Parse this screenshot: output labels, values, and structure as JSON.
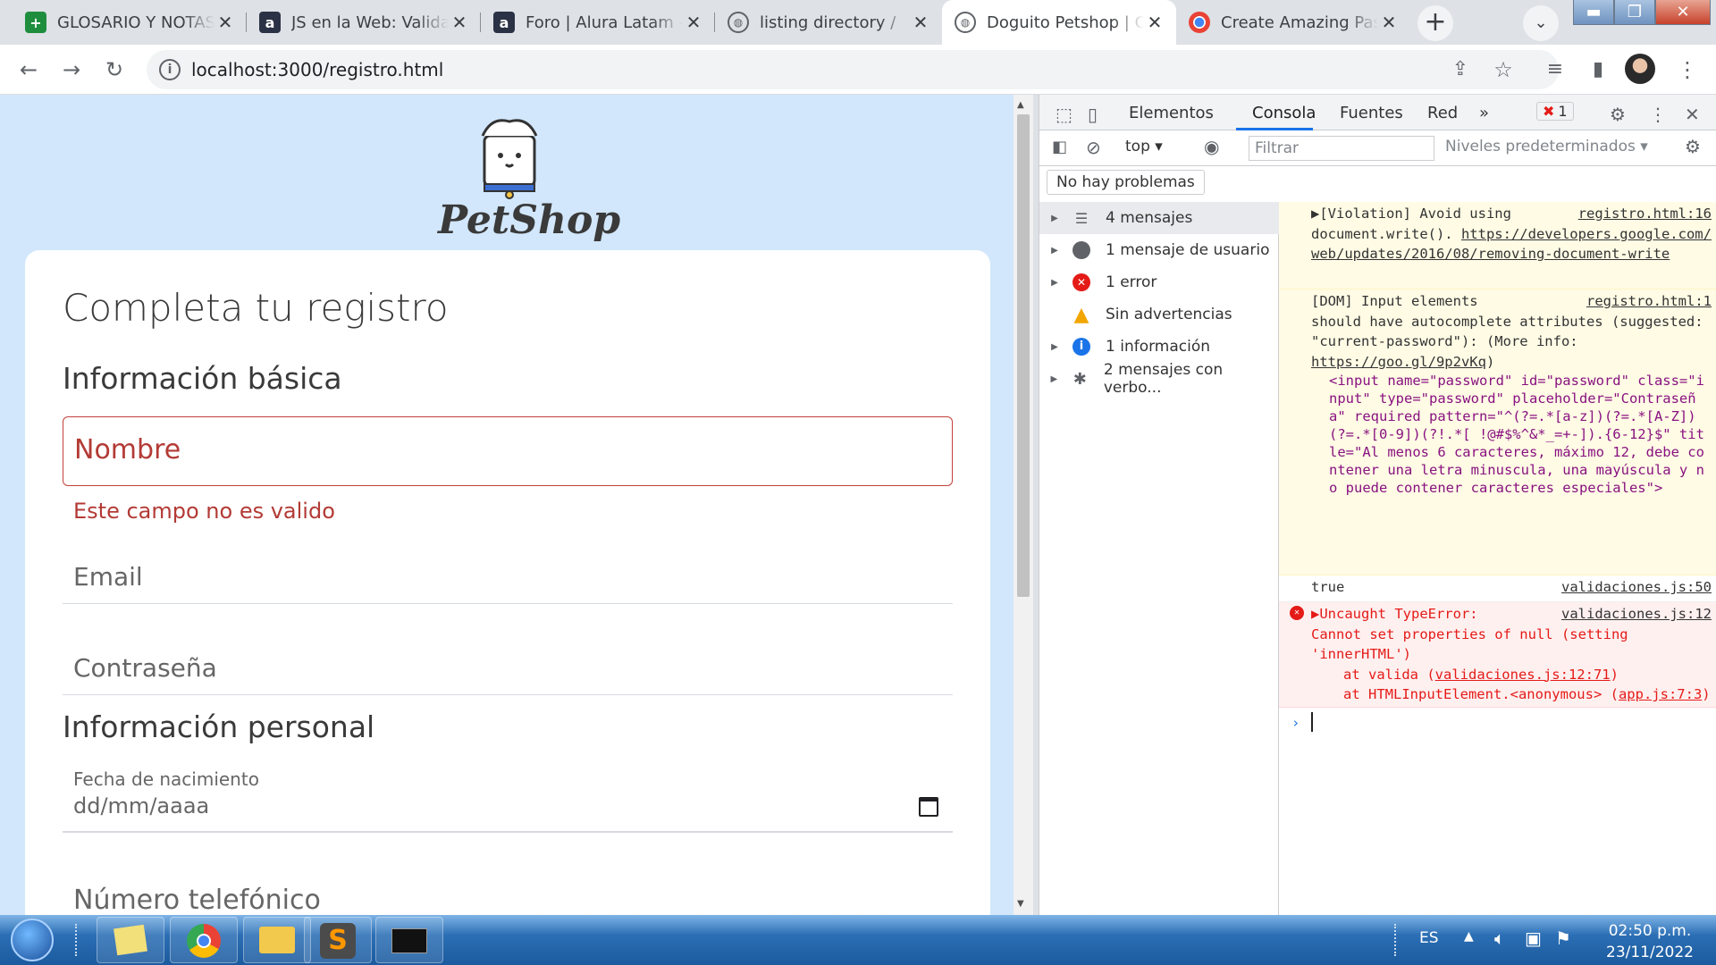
{
  "browser": {
    "tabs": [
      {
        "title": "GLOSARIO Y NOTAS",
        "favicon": "sheets-icon"
      },
      {
        "title": "JS en la Web: Validac",
        "favicon": "alura-icon"
      },
      {
        "title": "Foro | Alura Latam - C",
        "favicon": "alura-icon"
      },
      {
        "title": "listing directory /",
        "favicon": "globe-icon"
      },
      {
        "title": "Doguito Petshop | C",
        "favicon": "globe-icon",
        "active": true
      },
      {
        "title": "Create Amazing Pass",
        "favicon": "chrome-icon"
      }
    ],
    "url": "localhost:3000/registro.html"
  },
  "page": {
    "logo_text": "PetShop",
    "form_title": "Completa tu registro",
    "section_basic": "Información básica",
    "name_placeholder": "Nombre",
    "name_error": "Este campo no es valido",
    "email_placeholder": "Email",
    "password_placeholder": "Contraseña",
    "section_personal": "Información personal",
    "dob_label": "Fecha de nacimiento",
    "dob_value": "dd/mm/aaaa",
    "phone_placeholder": "Número telefónico"
  },
  "devtools": {
    "tabs": [
      "Elementos",
      "Consola",
      "Fuentes",
      "Red"
    ],
    "error_count": "1",
    "context": "top",
    "filter_placeholder": "Filtrar",
    "levels": "Niveles predeterminados",
    "no_problems": "No hay problemas",
    "sidebar": [
      "4 mensajes",
      "1 mensaje de usuario",
      "1 error",
      "Sin advertencias",
      "1 información",
      "2 mensajes con verbo..."
    ],
    "messages": {
      "violation_text": "▶[Violation] Avoid using",
      "violation_src": "registro.html:16",
      "violation_body": "document.write(). ",
      "violation_link": "https://developers.google.com/web/updates/2016/08/removing-document-write",
      "dom_text": "[DOM] Input elements",
      "dom_src": "registro.html:1",
      "dom_body": "should have autocomplete attributes (suggested: \"current-password\"): (More info: ",
      "dom_link": "https://goo.gl/9p2vKq",
      "dom_link_end": ")",
      "dom_element": "<input name=\"password\" id=\"password\" class=\"input\" type=\"password\" placeholder=\"Contraseña\" required pattern=\"^(?=.*[a-z])(?=.*[A-Z])(?=.*[0-9])(?!.*[ !@#$%^&*_=+-]).{6-12}$\" title=\"Al menos 6 caracteres, máximo 12, debe contener una letra minuscula, una mayúscula y no puede contener caracteres especiales\">",
      "true_text": "true",
      "true_src": "validaciones.js:50",
      "error_text": "▶Uncaught TypeError:",
      "error_src": "validaciones.js:12",
      "error_body": "Cannot set properties of null (setting 'innerHTML')",
      "error_stack1_pre": "at valida (",
      "error_stack1_link": "validaciones.js:12:71",
      "error_stack1_post": ")",
      "error_stack2_pre": "at HTMLInputElement.<anonymous> (",
      "error_stack2_link": "app.js:7:3",
      "error_stack2_post": ")"
    }
  },
  "taskbar": {
    "lang": "ES",
    "time": "02:50 p.m.",
    "date": "23/11/2022"
  }
}
